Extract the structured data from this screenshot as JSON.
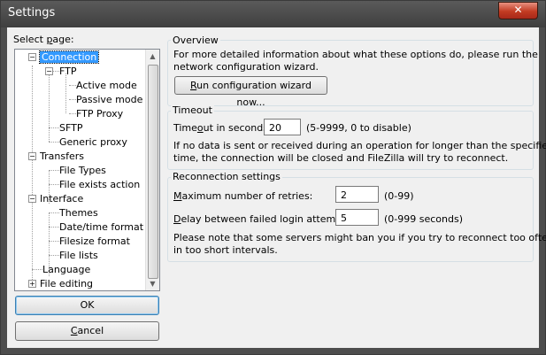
{
  "window": {
    "title": "Settings",
    "close_label": "✕"
  },
  "sidebar": {
    "select_label_prefix": "Select ",
    "select_label_accel": "p",
    "select_label_suffix": "age:",
    "tree": [
      {
        "label": "Connection",
        "selected": true
      },
      {
        "label": "FTP"
      },
      {
        "label": "Active mode"
      },
      {
        "label": "Passive mode"
      },
      {
        "label": "FTP Proxy"
      },
      {
        "label": "SFTP"
      },
      {
        "label": "Generic proxy"
      },
      {
        "label": "Transfers"
      },
      {
        "label": "File Types"
      },
      {
        "label": "File exists action"
      },
      {
        "label": "Interface"
      },
      {
        "label": "Themes"
      },
      {
        "label": "Date/time format"
      },
      {
        "label": "Filesize format"
      },
      {
        "label": "File lists"
      },
      {
        "label": "Language"
      },
      {
        "label": "File editing"
      }
    ],
    "ok_label": "OK",
    "cancel_accel": "C",
    "cancel_rest": "ancel"
  },
  "overview": {
    "title": "Overview",
    "line1": "For more detailed information about what these options do, please run the",
    "line2": "network configuration wizard.",
    "wizard_accel": "R",
    "wizard_rest": "un configuration wizard now..."
  },
  "timeout": {
    "title": "Timeout",
    "label_pre": "Time",
    "label_accel": "o",
    "label_post": "ut in seconds:",
    "value": "20",
    "hint": "(5-9999, 0 to disable)",
    "desc1": "If no data is sent or received during an operation for longer than the specified",
    "desc2": "time, the connection will be closed and FileZilla will try to reconnect."
  },
  "reconnect": {
    "title": "Reconnection settings",
    "retries_accel": "M",
    "retries_rest": "aximum number of retries:",
    "retries_value": "2",
    "retries_hint": "(0-99)",
    "delay_accel": "D",
    "delay_rest": "elay between failed login attempts:",
    "delay_value": "5",
    "delay_hint": "(0-999 seconds)",
    "note1": "Please note that some servers might ban you if you try to reconnect too often or",
    "note2": "in too short intervals."
  }
}
